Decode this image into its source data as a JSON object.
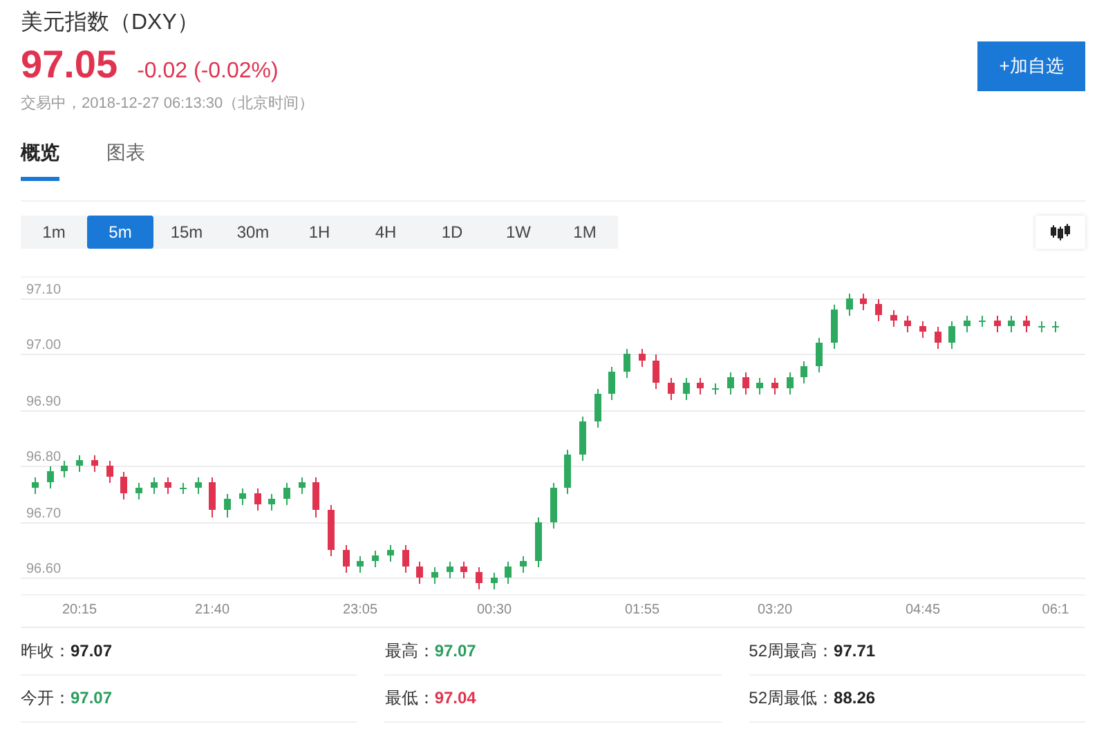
{
  "header": {
    "title": "美元指数（DXY）",
    "price": "97.05",
    "change": "-0.02 (-0.02%)",
    "status": "交易中，2018-12-27 06:13:30（北京时间）",
    "watch_button": "+加自选"
  },
  "tabs": [
    {
      "label": "概览",
      "selected": true
    },
    {
      "label": "图表",
      "selected": false
    }
  ],
  "periods": [
    {
      "label": "1m",
      "selected": false
    },
    {
      "label": "5m",
      "selected": true
    },
    {
      "label": "15m",
      "selected": false
    },
    {
      "label": "30m",
      "selected": false
    },
    {
      "label": "1H",
      "selected": false
    },
    {
      "label": "4H",
      "selected": false
    },
    {
      "label": "1D",
      "selected": false
    },
    {
      "label": "1W",
      "selected": false
    },
    {
      "label": "1M",
      "selected": false
    }
  ],
  "chart": {
    "chart_data": {
      "type": "candlestick",
      "grid": true,
      "yticks": [
        {
          "value": 96.6,
          "label": "96.60"
        },
        {
          "value": 96.7,
          "label": "96.70"
        },
        {
          "value": 96.8,
          "label": "96.80"
        },
        {
          "value": 96.9,
          "label": "96.90"
        },
        {
          "value": 97.0,
          "label": "97.00"
        },
        {
          "value": 97.1,
          "label": "97.10"
        }
      ],
      "ylim": [
        96.57,
        97.14
      ],
      "categories": [
        null,
        null,
        null,
        "20:15",
        null,
        null,
        null,
        null,
        null,
        null,
        null,
        null,
        "21:40",
        null,
        null,
        null,
        null,
        null,
        null,
        null,
        null,
        null,
        "23:05",
        null,
        null,
        null,
        null,
        null,
        null,
        null,
        null,
        "00:30",
        null,
        null,
        null,
        null,
        null,
        null,
        null,
        null,
        null,
        "01:55",
        null,
        null,
        null,
        null,
        null,
        null,
        null,
        null,
        "03:20",
        null,
        null,
        null,
        null,
        null,
        null,
        null,
        null,
        null,
        "04:45",
        null,
        null,
        null,
        null,
        null,
        null,
        null,
        null,
        "06:1"
      ],
      "ohlc": [
        [
          96.76,
          96.78,
          96.75,
          96.77
        ],
        [
          96.77,
          96.8,
          96.76,
          96.79
        ],
        [
          96.79,
          96.81,
          96.78,
          96.8
        ],
        [
          96.8,
          96.82,
          96.79,
          96.81
        ],
        [
          96.81,
          96.82,
          96.79,
          96.8
        ],
        [
          96.8,
          96.81,
          96.77,
          96.78
        ],
        [
          96.78,
          96.79,
          96.74,
          96.75
        ],
        [
          96.75,
          96.77,
          96.74,
          96.76
        ],
        [
          96.76,
          96.78,
          96.75,
          96.77
        ],
        [
          96.77,
          96.78,
          96.75,
          96.76
        ],
        [
          96.76,
          96.77,
          96.75,
          96.76
        ],
        [
          96.76,
          96.78,
          96.75,
          96.77
        ],
        [
          96.77,
          96.78,
          96.71,
          96.72
        ],
        [
          96.72,
          96.75,
          96.71,
          96.74
        ],
        [
          96.74,
          96.76,
          96.73,
          96.75
        ],
        [
          96.75,
          96.76,
          96.72,
          96.73
        ],
        [
          96.73,
          96.75,
          96.72,
          96.74
        ],
        [
          96.74,
          96.77,
          96.73,
          96.76
        ],
        [
          96.76,
          96.78,
          96.75,
          96.77
        ],
        [
          96.77,
          96.78,
          96.71,
          96.72
        ],
        [
          96.72,
          96.73,
          96.64,
          96.65
        ],
        [
          96.65,
          96.66,
          96.61,
          96.62
        ],
        [
          96.62,
          96.64,
          96.61,
          96.63
        ],
        [
          96.63,
          96.65,
          96.62,
          96.64
        ],
        [
          96.64,
          96.66,
          96.63,
          96.65
        ],
        [
          96.65,
          96.66,
          96.61,
          96.62
        ],
        [
          96.62,
          96.63,
          96.59,
          96.6
        ],
        [
          96.6,
          96.62,
          96.59,
          96.61
        ],
        [
          96.61,
          96.63,
          96.6,
          96.62
        ],
        [
          96.62,
          96.63,
          96.6,
          96.61
        ],
        [
          96.61,
          96.62,
          96.58,
          96.59
        ],
        [
          96.59,
          96.61,
          96.58,
          96.6
        ],
        [
          96.6,
          96.63,
          96.59,
          96.62
        ],
        [
          96.62,
          96.64,
          96.61,
          96.63
        ],
        [
          96.63,
          96.71,
          96.62,
          96.7
        ],
        [
          96.7,
          96.77,
          96.69,
          96.76
        ],
        [
          96.76,
          96.83,
          96.75,
          96.82
        ],
        [
          96.82,
          96.89,
          96.81,
          96.88
        ],
        [
          96.88,
          96.94,
          96.87,
          96.93
        ],
        [
          96.93,
          96.98,
          96.92,
          96.97
        ],
        [
          96.97,
          97.01,
          96.96,
          97.0
        ],
        [
          97.0,
          97.01,
          96.98,
          96.99
        ],
        [
          96.99,
          97.0,
          96.94,
          96.95
        ],
        [
          96.95,
          96.96,
          96.92,
          96.93
        ],
        [
          96.93,
          96.96,
          96.92,
          96.95
        ],
        [
          96.95,
          96.96,
          96.93,
          96.94
        ],
        [
          96.94,
          96.95,
          96.93,
          96.94
        ],
        [
          96.94,
          96.97,
          96.93,
          96.96
        ],
        [
          96.96,
          96.97,
          96.93,
          96.94
        ],
        [
          96.94,
          96.96,
          96.93,
          96.95
        ],
        [
          96.95,
          96.96,
          96.93,
          96.94
        ],
        [
          96.94,
          96.97,
          96.93,
          96.96
        ],
        [
          96.96,
          96.99,
          96.95,
          96.98
        ],
        [
          96.98,
          97.03,
          96.97,
          97.02
        ],
        [
          97.02,
          97.09,
          97.01,
          97.08
        ],
        [
          97.08,
          97.11,
          97.07,
          97.1
        ],
        [
          97.1,
          97.11,
          97.08,
          97.09
        ],
        [
          97.09,
          97.1,
          97.06,
          97.07
        ],
        [
          97.07,
          97.08,
          97.05,
          97.06
        ],
        [
          97.06,
          97.07,
          97.04,
          97.05
        ],
        [
          97.05,
          97.06,
          97.03,
          97.04
        ],
        [
          97.04,
          97.05,
          97.01,
          97.02
        ],
        [
          97.02,
          97.06,
          97.01,
          97.05
        ],
        [
          97.05,
          97.07,
          97.04,
          97.06
        ],
        [
          97.06,
          97.07,
          97.05,
          97.06
        ],
        [
          97.06,
          97.07,
          97.04,
          97.05
        ],
        [
          97.05,
          97.07,
          97.04,
          97.06
        ],
        [
          97.06,
          97.07,
          97.04,
          97.05
        ],
        [
          97.05,
          97.06,
          97.04,
          97.05
        ],
        [
          97.05,
          97.06,
          97.04,
          97.05
        ]
      ]
    }
  },
  "stats": [
    {
      "label": "昨收：",
      "value": "97.07",
      "color": "#222222"
    },
    {
      "label": "最高：",
      "value": "97.07",
      "color": "#2a9d5c"
    },
    {
      "label": "52周最高：",
      "value": "97.71",
      "color": "#222222"
    },
    {
      "label": "今开：",
      "value": "97.07",
      "color": "#2a9d5c"
    },
    {
      "label": "最低：",
      "value": "97.04",
      "color": "#e0334f"
    },
    {
      "label": "52周最低：",
      "value": "88.26",
      "color": "#222222"
    }
  ]
}
